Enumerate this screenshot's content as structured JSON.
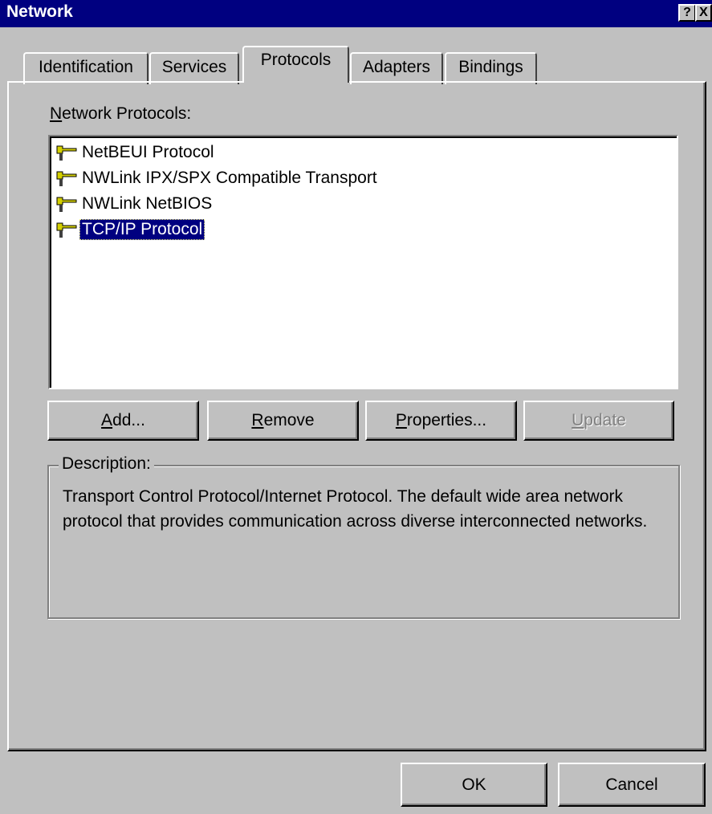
{
  "window": {
    "title": "Network",
    "help_label": "?",
    "close_label": "X"
  },
  "tabs": [
    {
      "label": "Identification",
      "active": false
    },
    {
      "label": "Services",
      "active": false
    },
    {
      "label": "Protocols",
      "active": true
    },
    {
      "label": "Adapters",
      "active": false
    },
    {
      "label": "Bindings",
      "active": false
    }
  ],
  "protocols": {
    "label_prefix": "N",
    "label_rest": "etwork Protocols:",
    "items": [
      {
        "icon": "network-protocol-icon",
        "label": "NetBEUI Protocol",
        "selected": false
      },
      {
        "icon": "network-protocol-icon",
        "label": "NWLink IPX/SPX Compatible Transport",
        "selected": false
      },
      {
        "icon": "network-protocol-icon",
        "label": "NWLink NetBIOS",
        "selected": false
      },
      {
        "icon": "network-protocol-icon",
        "label": "TCP/IP Protocol",
        "selected": true
      }
    ]
  },
  "buttons": {
    "add": {
      "accel": "A",
      "rest": "dd..."
    },
    "remove": {
      "accel": "R",
      "rest": "emove"
    },
    "properties": {
      "accel": "P",
      "rest": "roperties..."
    },
    "update": {
      "accel": "U",
      "rest": "pdate",
      "enabled": false
    }
  },
  "description": {
    "label": "Description:",
    "text": "Transport Control Protocol/Internet Protocol. The default wide area network protocol that provides communication across diverse interconnected networks."
  },
  "footer": {
    "ok_label": "OK",
    "cancel_label": "Cancel"
  },
  "colors": {
    "titlebar": "#000080",
    "face": "#c0c0c0",
    "selection": "#000080"
  }
}
